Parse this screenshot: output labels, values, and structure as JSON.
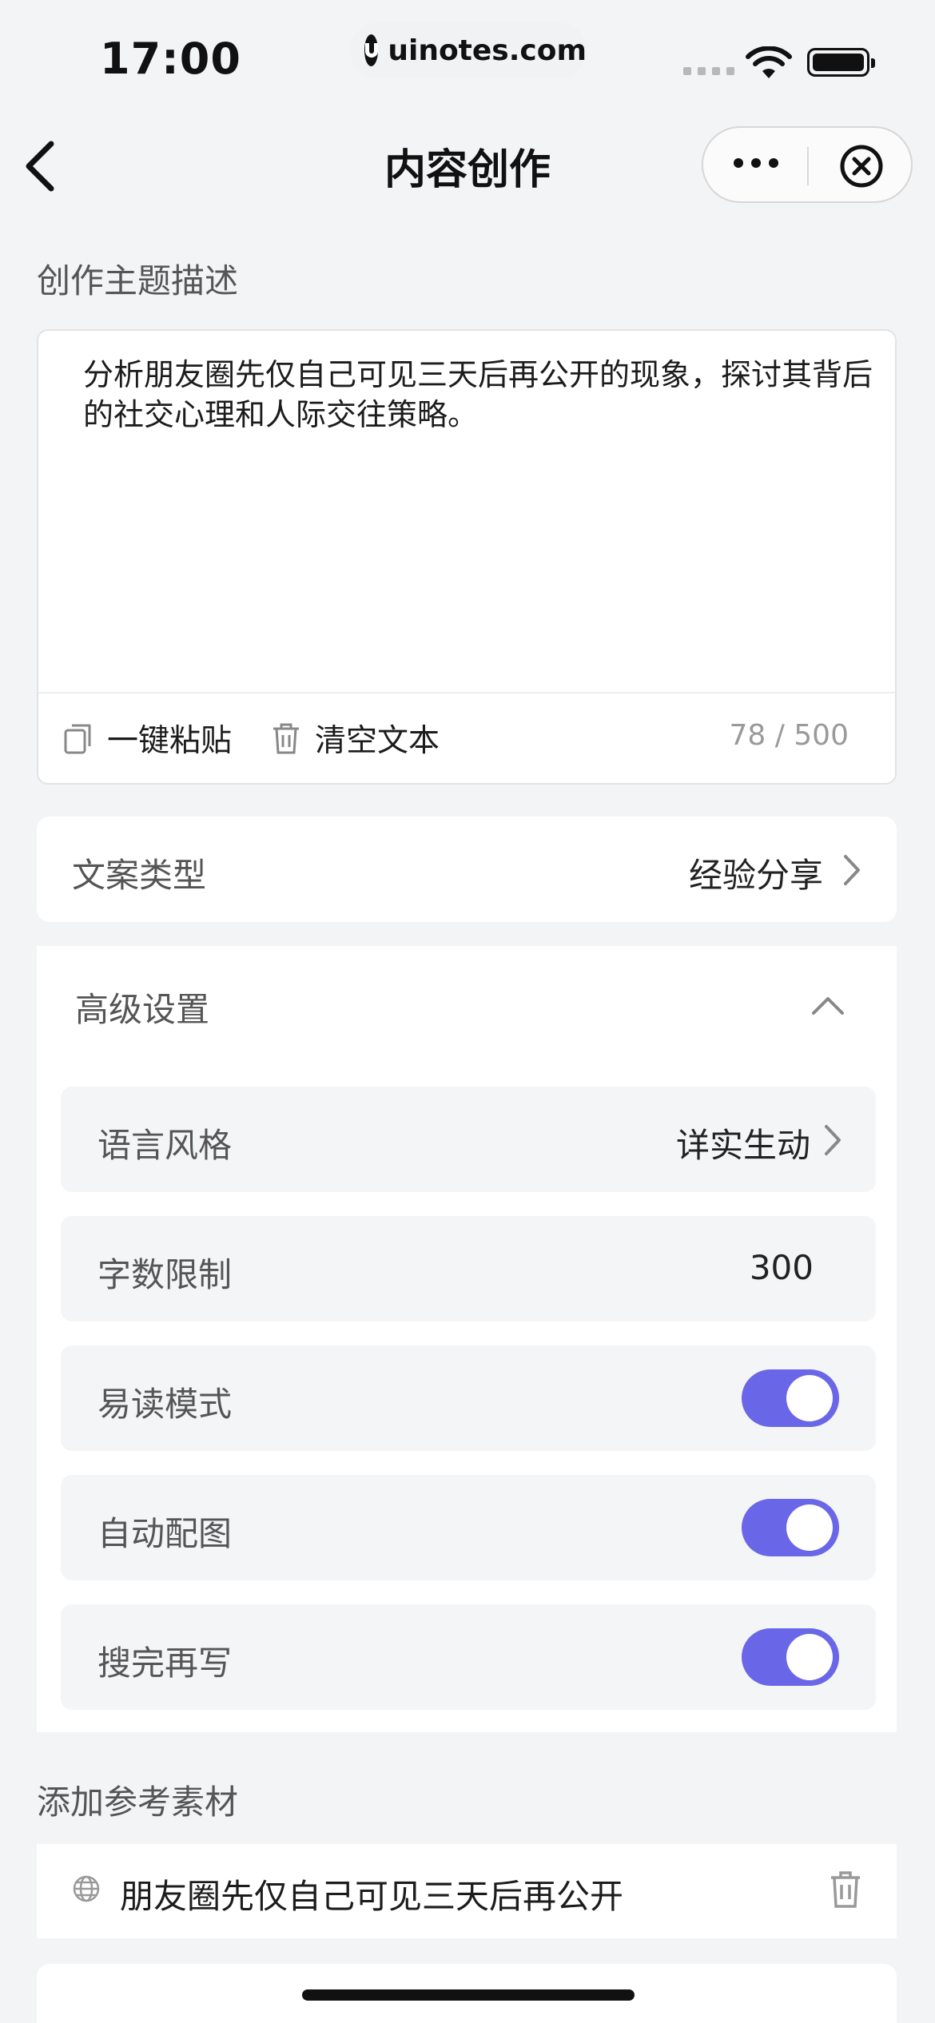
{
  "status_bar": {
    "time": "17:00",
    "url": "uinotes.com",
    "icons": [
      "signal-icon",
      "wifi-icon",
      "battery-icon"
    ]
  },
  "nav": {
    "title": "内容创作",
    "back_icon": "chevron-left-icon",
    "more_icon": "more-dots-icon",
    "close_icon": "close-circle-icon"
  },
  "topic": {
    "label": "创作主题描述",
    "text": "分析朋友圈先仅自己可见三天后再公开的现象，探讨其背后的社交心理和人际交往策略。",
    "paste_label": "一键粘贴",
    "clear_label": "清空文本",
    "counter": "78 / 500"
  },
  "copy_type": {
    "label": "文案类型",
    "value": "经验分享"
  },
  "advanced": {
    "title": "高级设置",
    "expanded": true,
    "style": {
      "label": "语言风格",
      "value": "详实生动"
    },
    "word_limit": {
      "label": "字数限制",
      "value": "300"
    },
    "toggles": [
      {
        "label": "易读模式",
        "on": true
      },
      {
        "label": "自动配图",
        "on": true
      },
      {
        "label": "搜完再写",
        "on": true
      }
    ]
  },
  "reference": {
    "label": "添加参考素材",
    "item": "朋友圈先仅自己可见三天后再公开"
  },
  "colors": {
    "accent": "#6a66e8",
    "background": "#f3f4f6"
  }
}
